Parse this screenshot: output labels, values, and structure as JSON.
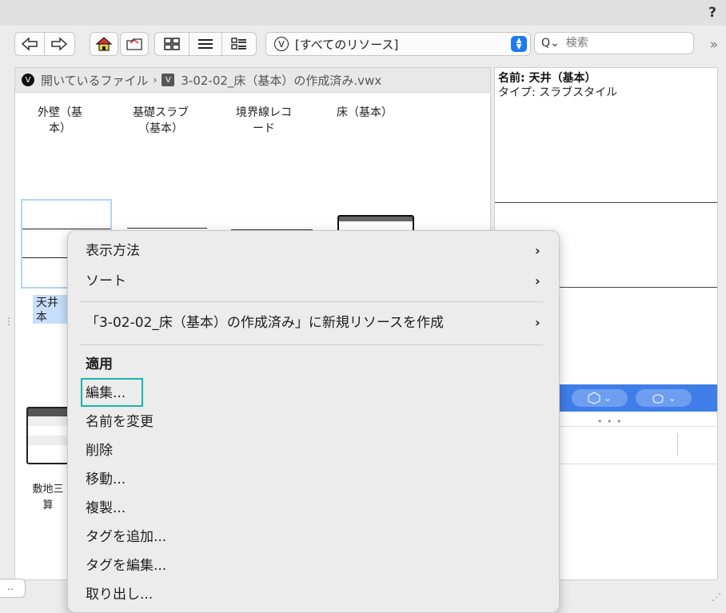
{
  "toolbar": {
    "help": "?",
    "resource_select": "[すべてのリソース]",
    "search_placeholder": "検索",
    "more": "»"
  },
  "breadcrumb": {
    "root": "開いているファイル",
    "file": "3-02-02_床（基本）の作成済み.vwx"
  },
  "resources": {
    "labels": [
      "外壁（基\n本）",
      "基礎スラブ\n（基本）",
      "境界線レコ\nード",
      "床（基本）"
    ],
    "selected_label": "天井\n本",
    "partial_label": "敷地三\n算"
  },
  "info": {
    "name_line": "名前: 天井（基本）",
    "type_line": "タイプ: スラブスタイル"
  },
  "bottom": {
    "left_button": ".."
  },
  "context_menu": {
    "items": [
      "表示方法",
      "ソート",
      "「3-02-02_床（基本）の作成済み」に新規リソースを作成",
      "適用",
      "編集...",
      "名前を変更",
      "削除",
      "移動...",
      "複製...",
      "タグを追加...",
      "タグを編集...",
      "取り出し..."
    ]
  },
  "colors": {
    "accent": "#3f7ee8",
    "focus": "#18b4ac",
    "selection": "#c8dffb"
  }
}
